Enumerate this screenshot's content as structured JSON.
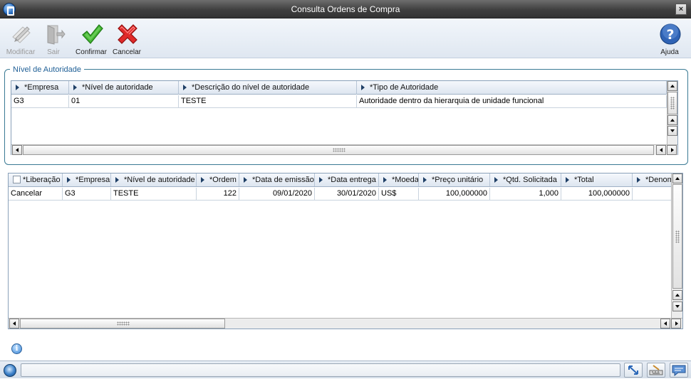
{
  "window": {
    "title": "Consulta Ordens de Compra",
    "close_glyph": "×"
  },
  "toolbar": {
    "modificar": "Modificar",
    "sair": "Sair",
    "confirmar": "Confirmar",
    "cancelar": "Cancelar",
    "ajuda": "Ajuda"
  },
  "authority_group": {
    "legend": "Nível de Autoridade",
    "headers": [
      "*Empresa",
      "*Nível de autoridade",
      "*Descrição do nível de autoridade",
      "*Tipo de Autoridade"
    ],
    "rows": [
      [
        "G3",
        "01",
        "TESTE",
        "Autoridade dentro da hierarquia de unidade funcional"
      ]
    ]
  },
  "orders_grid": {
    "headers": [
      "*Liberação",
      "*Empresa",
      "*Nível de autoridade",
      "*Ordem",
      "*Data de emissão",
      "*Data entrega",
      "*Moeda",
      "*Preço unitário",
      "*Qtd. Solicitada",
      "*Total",
      "*Denom"
    ],
    "rows": [
      [
        "Cancelar",
        "G3",
        "TESTE",
        "122",
        "09/01/2020",
        "30/01/2020",
        "US$",
        "100,000000",
        "1,000",
        "100,000000",
        ""
      ]
    ]
  },
  "icons": {
    "app": "totvs-logo-icon",
    "modificar": "pencil-paper-icon",
    "sair": "exit-door-icon",
    "confirmar": "checkmark-icon",
    "cancelar": "red-x-icon",
    "ajuda": "help-question-icon",
    "info": "info-icon"
  },
  "colors": {
    "accent": "#1f5f96",
    "confirm": "#3aa12a",
    "cancel": "#d62020",
    "help": "#2d5fb0"
  }
}
